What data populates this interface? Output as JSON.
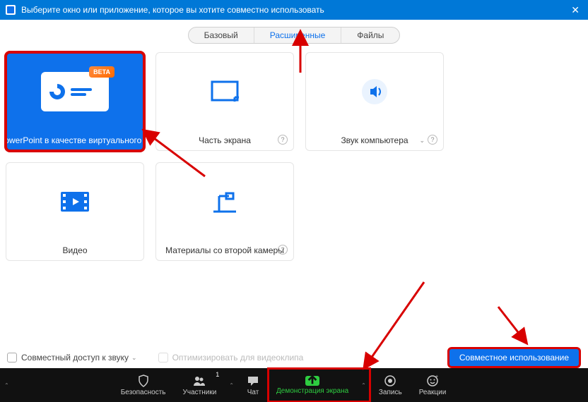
{
  "titlebar": {
    "title": "Выберите окно или приложение, которое вы хотите совместно использовать"
  },
  "tabs": {
    "basic": "Базовый",
    "advanced": "Расширенные",
    "files": "Файлы"
  },
  "cards": {
    "powerpoint": {
      "label": "PowerPoint в качестве виртуального ...",
      "beta": "BETA"
    },
    "portion": {
      "label": "Часть экрана"
    },
    "audio": {
      "label": "Звук компьютера"
    },
    "video": {
      "label": "Видео"
    },
    "camera2": {
      "label": "Материалы со второй камеры"
    }
  },
  "footer": {
    "shareAudio": "Совместный доступ к звуку",
    "optimize": "Оптимизировать для видеоклипа",
    "shareBtn": "Совместное использование"
  },
  "toolbar": {
    "security": "Безопасность",
    "participants": "Участники",
    "participantsCount": "1",
    "chat": "Чат",
    "shareScreen": "Демонстрация экрана",
    "record": "Запись",
    "reactions": "Реакции"
  }
}
